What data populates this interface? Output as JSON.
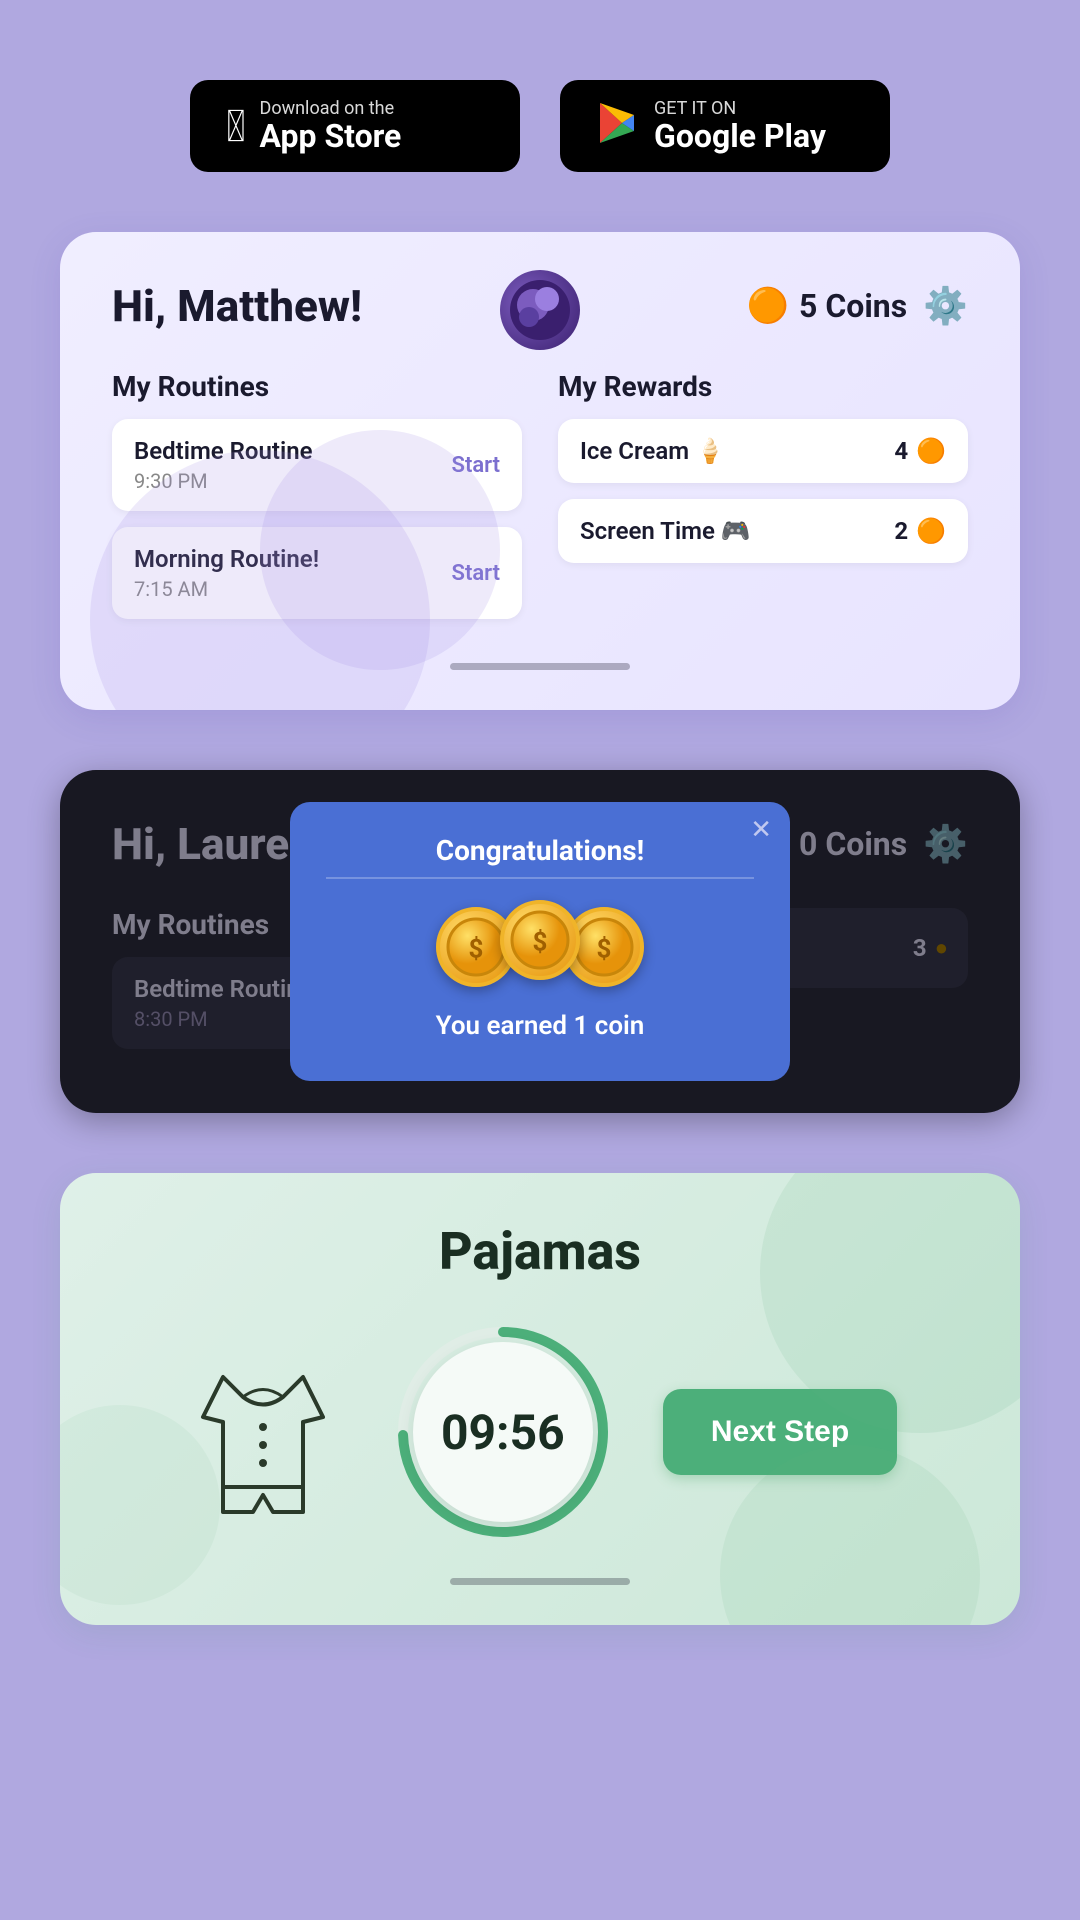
{
  "background": "#b0a8e0",
  "store_buttons": {
    "app_store": {
      "label_small": "Download on the",
      "label_large": "App Store",
      "icon": "apple"
    },
    "google_play": {
      "label_small": "GET IT ON",
      "label_large": "Google Play",
      "icon": "play"
    }
  },
  "card_matthew": {
    "greeting": "Hi, Matthew!",
    "coins": 5,
    "coins_label": "Coins",
    "routines_label": "My Routines",
    "rewards_label": "My Rewards",
    "routines": [
      {
        "name": "Bedtime Routine",
        "time": "9:30 PM",
        "action": "Start"
      },
      {
        "name": "Morning Routine!",
        "time": "7:15 AM",
        "action": "Start"
      }
    ],
    "rewards": [
      {
        "name": "Ice Cream 🍦",
        "cost": 4
      },
      {
        "name": "Screen Time 🎮",
        "cost": 2
      }
    ]
  },
  "card_lauren": {
    "greeting": "Hi, Lauren!",
    "coins": 0,
    "coins_label": "Coins",
    "routines_label": "My Routines",
    "routines": [
      {
        "name": "Bedtime Routine",
        "time": "8:30 PM"
      }
    ],
    "modal": {
      "title": "Congratulations!",
      "coins_count": 3,
      "message": "You earned 1 coin"
    }
  },
  "card_pajamas": {
    "title": "Pajamas",
    "timer": "09:56",
    "next_step_label": "Next Step"
  }
}
